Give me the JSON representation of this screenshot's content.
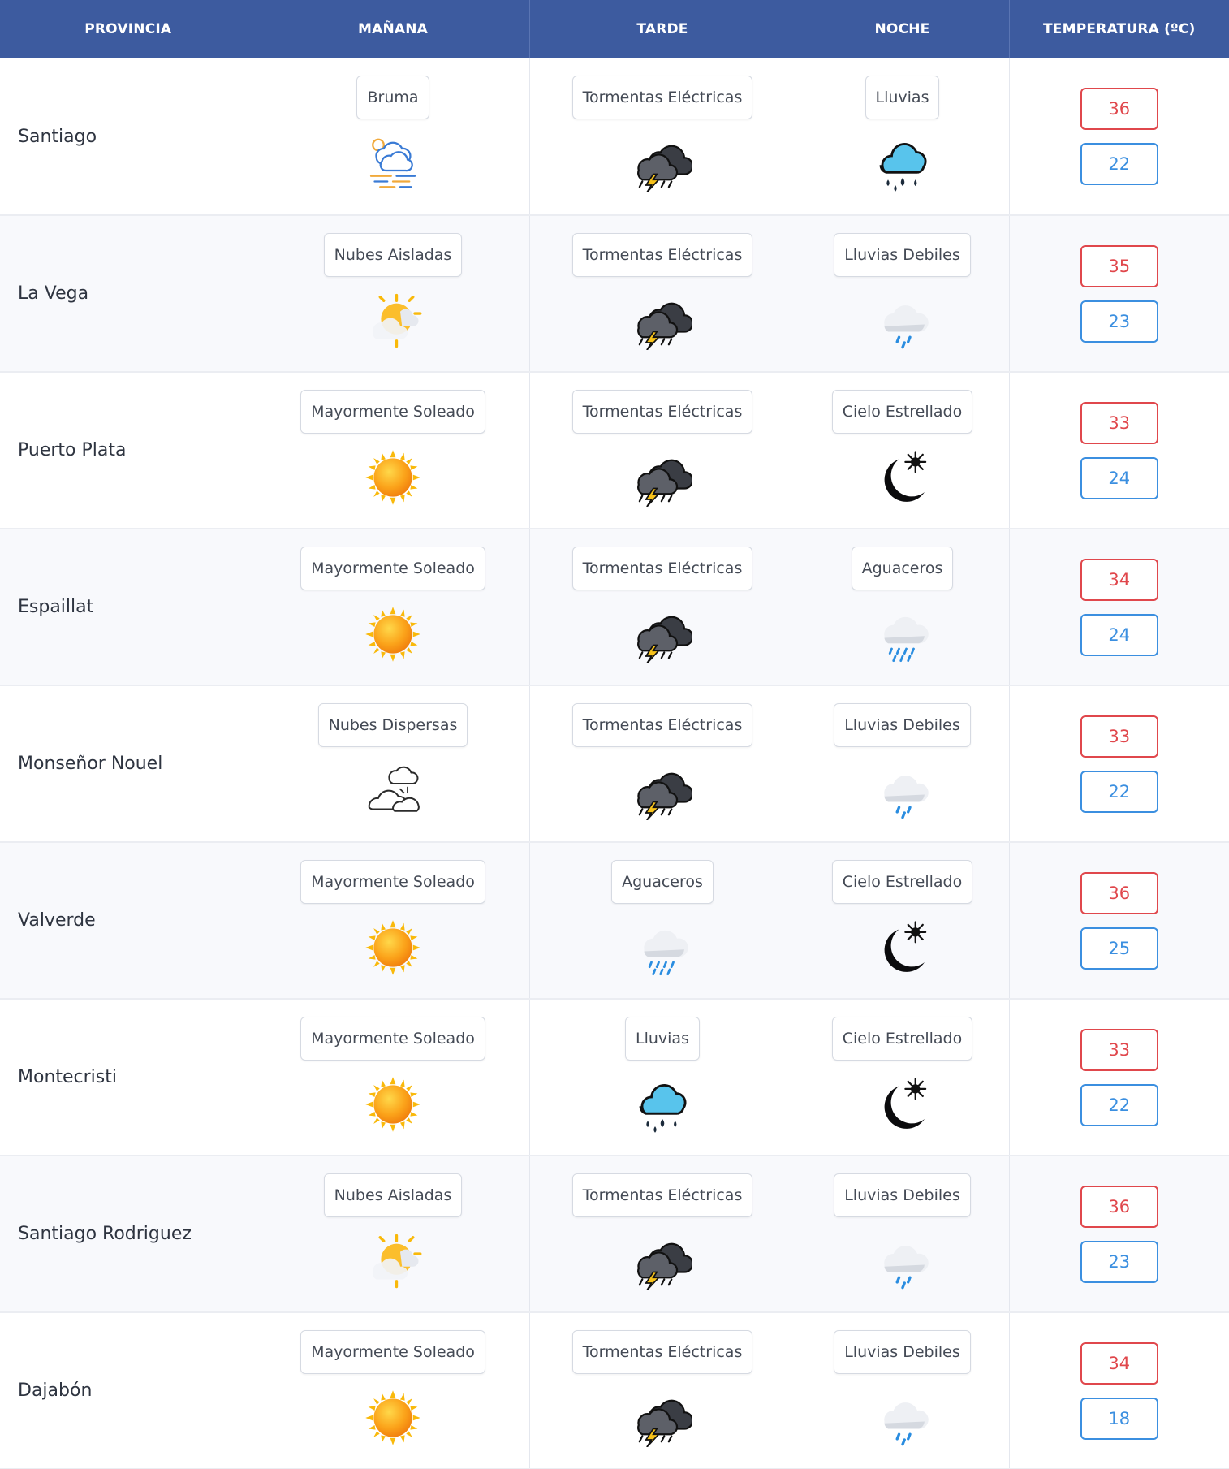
{
  "headers": {
    "provincia": "PROVINCIA",
    "manana": "MAÑANA",
    "tarde": "TARDE",
    "noche": "NOCHE",
    "temperatura": "TEMPERATURA (ºC)"
  },
  "colors": {
    "header_bg": "#3d5b9f",
    "max_temp": "#e0474c",
    "min_temp": "#3b8fe0"
  },
  "rows": [
    {
      "provincia": "Santiago",
      "manana": {
        "label": "Bruma",
        "icon": "fog-icon"
      },
      "tarde": {
        "label": "Tormentas Eléctricas",
        "icon": "thunderstorm-icon"
      },
      "noche": {
        "label": "Lluvias",
        "icon": "rain-cloud-icon"
      },
      "max": "36",
      "min": "22"
    },
    {
      "provincia": "La Vega",
      "manana": {
        "label": "Nubes Aisladas",
        "icon": "partly-sunny-icon"
      },
      "tarde": {
        "label": "Tormentas Eléctricas",
        "icon": "thunderstorm-icon"
      },
      "noche": {
        "label": "Lluvias Debiles",
        "icon": "light-rain-icon"
      },
      "max": "35",
      "min": "23"
    },
    {
      "provincia": "Puerto Plata",
      "manana": {
        "label": "Mayormente Soleado",
        "icon": "sun-icon"
      },
      "tarde": {
        "label": "Tormentas Eléctricas",
        "icon": "thunderstorm-icon"
      },
      "noche": {
        "label": "Cielo Estrellado",
        "icon": "moon-star-icon"
      },
      "max": "33",
      "min": "24"
    },
    {
      "provincia": "Espaillat",
      "manana": {
        "label": "Mayormente Soleado",
        "icon": "sun-icon"
      },
      "tarde": {
        "label": "Tormentas Eléctricas",
        "icon": "thunderstorm-icon"
      },
      "noche": {
        "label": "Aguaceros",
        "icon": "showers-icon"
      },
      "max": "34",
      "min": "24"
    },
    {
      "provincia": "Monseñor Nouel",
      "manana": {
        "label": "Nubes Dispersas",
        "icon": "scattered-clouds-icon"
      },
      "tarde": {
        "label": "Tormentas Eléctricas",
        "icon": "thunderstorm-icon"
      },
      "noche": {
        "label": "Lluvias Debiles",
        "icon": "light-rain-icon"
      },
      "max": "33",
      "min": "22"
    },
    {
      "provincia": "Valverde",
      "manana": {
        "label": "Mayormente Soleado",
        "icon": "sun-icon"
      },
      "tarde": {
        "label": "Aguaceros",
        "icon": "showers-icon"
      },
      "noche": {
        "label": "Cielo Estrellado",
        "icon": "moon-star-icon"
      },
      "max": "36",
      "min": "25"
    },
    {
      "provincia": "Montecristi",
      "manana": {
        "label": "Mayormente Soleado",
        "icon": "sun-icon"
      },
      "tarde": {
        "label": "Lluvias",
        "icon": "rain-cloud-icon"
      },
      "noche": {
        "label": "Cielo Estrellado",
        "icon": "moon-star-icon"
      },
      "max": "33",
      "min": "22"
    },
    {
      "provincia": "Santiago Rodriguez",
      "manana": {
        "label": "Nubes Aisladas",
        "icon": "partly-sunny-icon"
      },
      "tarde": {
        "label": "Tormentas Eléctricas",
        "icon": "thunderstorm-icon"
      },
      "noche": {
        "label": "Lluvias Debiles",
        "icon": "light-rain-icon"
      },
      "max": "36",
      "min": "23"
    },
    {
      "provincia": "Dajabón",
      "manana": {
        "label": "Mayormente Soleado",
        "icon": "sun-icon"
      },
      "tarde": {
        "label": "Tormentas Eléctricas",
        "icon": "thunderstorm-icon"
      },
      "noche": {
        "label": "Lluvias Debiles",
        "icon": "light-rain-icon"
      },
      "max": "34",
      "min": "18"
    }
  ]
}
